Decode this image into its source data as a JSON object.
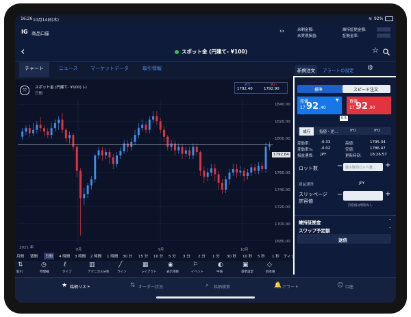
{
  "status": {
    "time": "16:26",
    "date": "10月14日(木)",
    "battery": "92%"
  },
  "account": {
    "logo": "IG",
    "name": "商品口座",
    "expand": "››",
    "margin_label": "余剰金額:",
    "unrealized_label": "未実現損益:",
    "maintenance_label": "維持証拠金額:",
    "deposit_label": "証拠金率:"
  },
  "title": {
    "back": "‹",
    "market": "スポット金 (円建て- ¥100)",
    "star": "☆",
    "search": "search"
  },
  "tabs": [
    "チャート",
    "ニュース",
    "マーケットデータ",
    "取引情報"
  ],
  "chart": {
    "name": "スポット金 (円建て- ¥100) (-)",
    "timeframe": "日間",
    "sell_box": "売り",
    "sell_price": "1792.40",
    "buy_box": "買い",
    "buy_price": "1792.90",
    "current": "1792.64",
    "year": "2021 年",
    "month_labels": [
      "8月",
      "9月",
      "10月"
    ]
  },
  "chart_data": {
    "type": "candlestick",
    "title": "スポット金 (円建て- ¥100) (-)",
    "yticks": [
      1840,
      1820,
      1800,
      1780,
      1760,
      1740,
      1720,
      1700,
      1680
    ],
    "ylim": [
      1675,
      1845
    ],
    "candles": [
      {
        "o": 1802,
        "c": 1808,
        "h": 1812,
        "l": 1798
      },
      {
        "o": 1808,
        "c": 1812,
        "h": 1815,
        "l": 1804
      },
      {
        "o": 1812,
        "c": 1806,
        "h": 1816,
        "l": 1802
      },
      {
        "o": 1806,
        "c": 1810,
        "h": 1818,
        "l": 1803
      },
      {
        "o": 1810,
        "c": 1816,
        "h": 1820,
        "l": 1806
      },
      {
        "o": 1816,
        "c": 1812,
        "h": 1825,
        "l": 1808
      },
      {
        "o": 1812,
        "c": 1808,
        "h": 1815,
        "l": 1802
      },
      {
        "o": 1808,
        "c": 1804,
        "h": 1812,
        "l": 1800
      },
      {
        "o": 1804,
        "c": 1812,
        "h": 1818,
        "l": 1800
      },
      {
        "o": 1812,
        "c": 1818,
        "h": 1822,
        "l": 1808
      },
      {
        "o": 1818,
        "c": 1822,
        "h": 1826,
        "l": 1810
      },
      {
        "o": 1822,
        "c": 1810,
        "h": 1830,
        "l": 1806
      },
      {
        "o": 1810,
        "c": 1800,
        "h": 1812,
        "l": 1796
      },
      {
        "o": 1800,
        "c": 1804,
        "h": 1808,
        "l": 1794
      },
      {
        "o": 1804,
        "c": 1790,
        "h": 1806,
        "l": 1786
      },
      {
        "o": 1790,
        "c": 1762,
        "h": 1792,
        "l": 1755
      },
      {
        "o": 1762,
        "c": 1730,
        "h": 1765,
        "l": 1686
      },
      {
        "o": 1730,
        "c": 1735,
        "h": 1742,
        "l": 1722
      },
      {
        "o": 1735,
        "c": 1745,
        "h": 1748,
        "l": 1730
      },
      {
        "o": 1745,
        "c": 1752,
        "h": 1756,
        "l": 1740
      },
      {
        "o": 1752,
        "c": 1780,
        "h": 1782,
        "l": 1748
      },
      {
        "o": 1780,
        "c": 1786,
        "h": 1790,
        "l": 1776
      },
      {
        "o": 1786,
        "c": 1780,
        "h": 1790,
        "l": 1774
      },
      {
        "o": 1780,
        "c": 1784,
        "h": 1788,
        "l": 1776
      },
      {
        "o": 1784,
        "c": 1778,
        "h": 1788,
        "l": 1770
      },
      {
        "o": 1778,
        "c": 1770,
        "h": 1782,
        "l": 1764
      },
      {
        "o": 1770,
        "c": 1780,
        "h": 1784,
        "l": 1766
      },
      {
        "o": 1780,
        "c": 1785,
        "h": 1790,
        "l": 1776
      },
      {
        "o": 1785,
        "c": 1794,
        "h": 1798,
        "l": 1782
      },
      {
        "o": 1794,
        "c": 1790,
        "h": 1798,
        "l": 1784
      },
      {
        "o": 1790,
        "c": 1796,
        "h": 1800,
        "l": 1786
      },
      {
        "o": 1796,
        "c": 1804,
        "h": 1810,
        "l": 1792
      },
      {
        "o": 1804,
        "c": 1812,
        "h": 1818,
        "l": 1800
      },
      {
        "o": 1812,
        "c": 1816,
        "h": 1822,
        "l": 1808
      },
      {
        "o": 1816,
        "c": 1810,
        "h": 1820,
        "l": 1806
      },
      {
        "o": 1810,
        "c": 1822,
        "h": 1826,
        "l": 1806
      },
      {
        "o": 1822,
        "c": 1826,
        "h": 1832,
        "l": 1818
      },
      {
        "o": 1826,
        "c": 1820,
        "h": 1832,
        "l": 1816
      },
      {
        "o": 1820,
        "c": 1810,
        "h": 1824,
        "l": 1806
      },
      {
        "o": 1810,
        "c": 1802,
        "h": 1814,
        "l": 1796
      },
      {
        "o": 1802,
        "c": 1790,
        "h": 1804,
        "l": 1786
      },
      {
        "o": 1790,
        "c": 1794,
        "h": 1798,
        "l": 1786
      },
      {
        "o": 1794,
        "c": 1786,
        "h": 1798,
        "l": 1780
      },
      {
        "o": 1786,
        "c": 1790,
        "h": 1794,
        "l": 1782
      },
      {
        "o": 1790,
        "c": 1782,
        "h": 1794,
        "l": 1776
      },
      {
        "o": 1782,
        "c": 1786,
        "h": 1790,
        "l": 1778
      },
      {
        "o": 1786,
        "c": 1780,
        "h": 1790,
        "l": 1776
      },
      {
        "o": 1780,
        "c": 1790,
        "h": 1794,
        "l": 1776
      },
      {
        "o": 1790,
        "c": 1784,
        "h": 1794,
        "l": 1780
      },
      {
        "o": 1784,
        "c": 1762,
        "h": 1786,
        "l": 1756
      },
      {
        "o": 1762,
        "c": 1755,
        "h": 1768,
        "l": 1748
      },
      {
        "o": 1755,
        "c": 1760,
        "h": 1765,
        "l": 1750
      },
      {
        "o": 1760,
        "c": 1765,
        "h": 1770,
        "l": 1756
      },
      {
        "o": 1765,
        "c": 1758,
        "h": 1770,
        "l": 1750
      },
      {
        "o": 1758,
        "c": 1748,
        "h": 1762,
        "l": 1740
      },
      {
        "o": 1748,
        "c": 1740,
        "h": 1752,
        "l": 1735
      },
      {
        "o": 1740,
        "c": 1752,
        "h": 1756,
        "l": 1736
      },
      {
        "o": 1752,
        "c": 1760,
        "h": 1764,
        "l": 1746
      },
      {
        "o": 1760,
        "c": 1764,
        "h": 1770,
        "l": 1756
      },
      {
        "o": 1764,
        "c": 1760,
        "h": 1770,
        "l": 1754
      },
      {
        "o": 1760,
        "c": 1762,
        "h": 1768,
        "l": 1756
      },
      {
        "o": 1762,
        "c": 1756,
        "h": 1766,
        "l": 1750
      },
      {
        "o": 1756,
        "c": 1760,
        "h": 1764,
        "l": 1752
      },
      {
        "o": 1760,
        "c": 1766,
        "h": 1770,
        "l": 1756
      },
      {
        "o": 1766,
        "c": 1762,
        "h": 1770,
        "l": 1758
      },
      {
        "o": 1762,
        "c": 1768,
        "h": 1772,
        "l": 1758
      },
      {
        "o": 1768,
        "c": 1764,
        "h": 1772,
        "l": 1760
      },
      {
        "o": 1764,
        "c": 1790,
        "h": 1795,
        "l": 1760
      },
      {
        "o": 1790,
        "c": 1792,
        "h": 1796,
        "l": 1786
      }
    ]
  },
  "timeframes": [
    "月間",
    "週間",
    "日間",
    "4 時間",
    "3 時間",
    "2 時間",
    "1 時間",
    "30 分",
    "15 分",
    "10 分",
    "5 分",
    "3 分",
    "2 分",
    "1 分",
    "30 秒",
    "10 秒",
    "5 秒",
    "1 秒",
    "ティック"
  ],
  "tools": [
    "取引",
    "時間軸",
    "タイプ",
    "テクニカル分析",
    "ライン",
    "レイアウト",
    "表示項目",
    "イベント",
    "中値",
    "基準設定",
    "四本値"
  ],
  "panel": {
    "tab_new": "新規注文",
    "tab_alert": "アラートの設定",
    "mode_standard": "標準",
    "mode_speed": "スピード注文",
    "sell_label": "売値",
    "sell_price_big": "92",
    "sell_price_small": "17",
    "sell_price_dec": ".40",
    "buy_label": "買値",
    "buy_price_big": "92",
    "buy_price_small": "17",
    "buy_price_dec": ".90",
    "spread": "0.5",
    "order_types": [
      "成行",
      "指値・逆…",
      "IFD",
      "IFO"
    ],
    "stats": [
      [
        "変動率:",
        "-0.33",
        "高値:",
        "1795.34"
      ],
      [
        "変動率%:",
        "-0.02",
        "安値:",
        "1786.47"
      ],
      [
        "損益通貨:",
        "JPY",
        "更新時刻:",
        "16:26:57"
      ]
    ],
    "lots_label": "ロット数",
    "lots_placeholder": "最小取引ロット数…",
    "currency_label": "損益通貨",
    "currency_value": "JPY",
    "slippage_label": "スリッページ\n許容値",
    "slippage_note": "許容値は制限なし",
    "margin_label": "維持証拠金",
    "swap_label": "スワップ予定額",
    "submit": "送信"
  },
  "nav": [
    "銘柄リスト",
    "オーダー状況",
    "銘柄検索",
    "アラート",
    "口座"
  ]
}
